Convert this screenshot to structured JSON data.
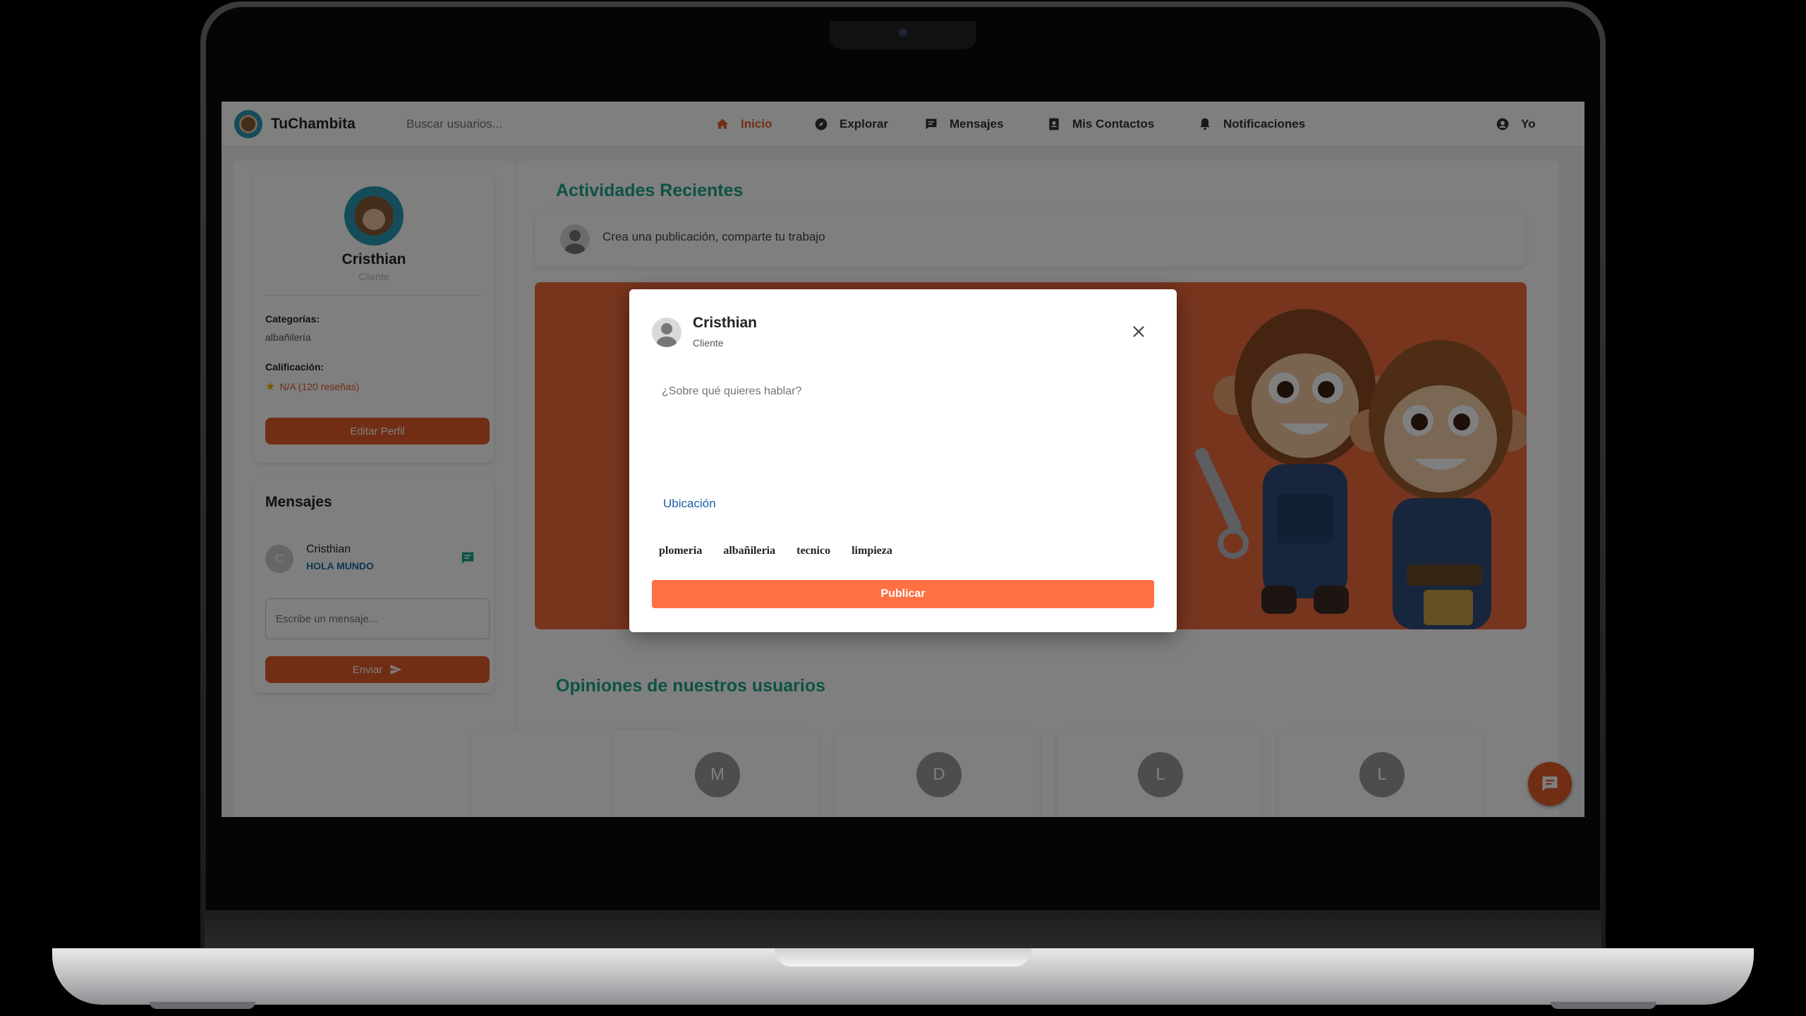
{
  "app": {
    "brand": "TuChambita"
  },
  "search": {
    "placeholder": "Buscar usuarios..."
  },
  "nav": {
    "inicio": "Inicio",
    "explorar": "Explorar",
    "mensajes": "Mensajes",
    "contactos": "Mis Contactos",
    "notificaciones": "Notificaciones",
    "yo": "Yo"
  },
  "profile": {
    "name": "Cristhian",
    "role": "Cliente",
    "categories_label": "Categorías:",
    "categories_value": "albañilería",
    "rating_label": "Calificación:",
    "rating_value": "N/A (120 reseñas)",
    "edit_button": "Editar Perfil"
  },
  "messages": {
    "title": "Mensajes",
    "items": [
      {
        "initial": "C",
        "name": "Cristhian",
        "text": "HOLA MUNDO"
      }
    ],
    "input_placeholder": "Escribe un mensaje...",
    "send_button": "Enviar"
  },
  "main": {
    "activities_title": "Actividades Recientes",
    "composer_text": "Crea una publicación, comparte tu trabajo",
    "opinions_title": "Opiniones de nuestros usuarios",
    "reviews": [
      {
        "initial": "M"
      },
      {
        "initial": "D"
      },
      {
        "initial": "L"
      },
      {
        "initial": "L"
      }
    ]
  },
  "modal": {
    "name": "Cristhian",
    "role": "Cliente",
    "textarea_placeholder": "¿Sobre qué quieres hablar?",
    "location_label": "Ubicación",
    "tags": [
      "plomeria",
      "albañileria",
      "tecnico",
      "limpieza"
    ],
    "publish_button": "Publicar"
  },
  "colors": {
    "accent": "#e45b2b",
    "title_green": "#1aa58a",
    "publish": "#ff7043"
  }
}
